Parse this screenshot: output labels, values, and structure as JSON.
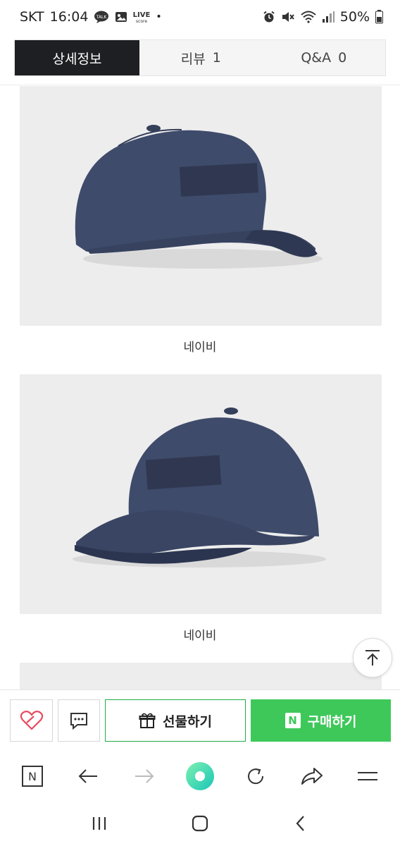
{
  "status_bar": {
    "carrier": "SKT",
    "time": "16:04",
    "dot": "•",
    "battery": "50%",
    "icons": [
      "talk-icon",
      "image-icon",
      "livescore-icon",
      "alarm-icon",
      "mute-icon",
      "wifi-icon",
      "signal-icon",
      "battery-icon"
    ],
    "live_label_top": "LIVE",
    "live_label_bottom": "score"
  },
  "tabs": [
    {
      "label": "상세정보",
      "count": ""
    },
    {
      "label": "리뷰",
      "count": "1"
    },
    {
      "label": "Q&A",
      "count": "0"
    }
  ],
  "products": [
    {
      "caption": "네이비",
      "image": "navy-cap-image"
    },
    {
      "caption": "네이비",
      "image": "navy-cap-image"
    }
  ],
  "buy_bar": {
    "gift_label": "선물하기",
    "buy_label": "구매하기",
    "n_logo": "N"
  },
  "browser_bar": {
    "n_label": "N",
    "icons": [
      "naver-home-icon",
      "back-icon",
      "forward-icon",
      "green-dot-icon",
      "reload-icon",
      "share-icon",
      "menu-icon"
    ]
  },
  "nav_bar": {
    "icons": [
      "recent-apps-icon",
      "home-icon",
      "back-icon"
    ]
  },
  "colors": {
    "tab_active": "#1e1f23",
    "buy_green": "#3ec85a",
    "gift_border": "#22a949",
    "image_bg": "#ededed",
    "cap_navy": "#3f4b6b"
  }
}
